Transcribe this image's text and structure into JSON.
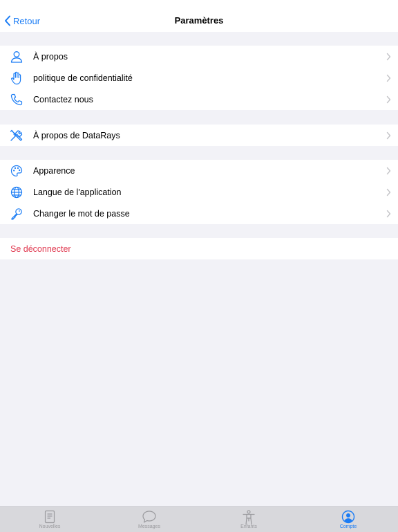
{
  "navbar": {
    "back_label": "Retour",
    "title": "Paramètres"
  },
  "sections": [
    {
      "items": [
        {
          "label": "À propos",
          "icon": "person-icon"
        },
        {
          "label": "politique de confidentialité",
          "icon": "hand-icon"
        },
        {
          "label": "Contactez nous",
          "icon": "phone-icon"
        }
      ]
    },
    {
      "items": [
        {
          "label": "À propos de DataRays",
          "icon": "tools-icon"
        }
      ]
    },
    {
      "items": [
        {
          "label": "Apparence",
          "icon": "palette-icon"
        },
        {
          "label": "Langue de l'application",
          "icon": "globe-icon"
        },
        {
          "label": "Changer le mot de passe",
          "icon": "key-icon"
        }
      ]
    }
  ],
  "logout_label": "Se déconnecter",
  "tabbar": {
    "tabs": [
      {
        "label": "Nouvelles",
        "icon": "newspaper-icon",
        "active": false
      },
      {
        "label": "Messages",
        "icon": "chat-bubble-icon",
        "active": false
      },
      {
        "label": "Enfants",
        "icon": "figure-icon",
        "active": false
      },
      {
        "label": "Compte",
        "icon": "account-circle-icon",
        "active": true
      }
    ]
  },
  "colors": {
    "accent": "#1a7cf5",
    "destructive": "#e0384f",
    "background": "#f2f2f7",
    "tab_inactive": "#9a9a9e"
  }
}
